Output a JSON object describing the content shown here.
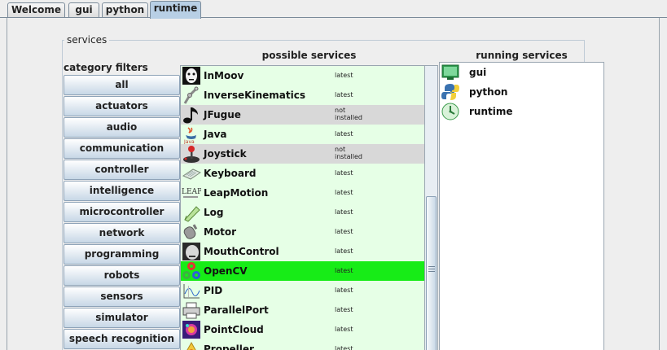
{
  "tabs": [
    "Welcome",
    "gui",
    "python",
    "runtime"
  ],
  "services_title": "services",
  "category_filters": {
    "title": "category filters",
    "items": [
      "all",
      "actuators",
      "audio",
      "communication",
      "controller",
      "intelligence",
      "microcontroller",
      "network",
      "programming",
      "robots",
      "sensors",
      "simulator",
      "speech recognition"
    ]
  },
  "possible_services": {
    "title": "possible services",
    "rows": [
      {
        "name": "InMoov",
        "status": "latest",
        "icon": "inmoov-face-icon"
      },
      {
        "name": "InverseKinematics",
        "status": "latest",
        "icon": "robot-arm-icon"
      },
      {
        "name": "JFugue",
        "status": "not installed",
        "status_line1": "not",
        "status_line2": "installed",
        "icon": "music-note-icon"
      },
      {
        "name": "Java",
        "status": "latest",
        "icon": "java-icon"
      },
      {
        "name": "Joystick",
        "status": "not installed",
        "status_line1": "not",
        "status_line2": "installed",
        "icon": "joystick-icon"
      },
      {
        "name": "Keyboard",
        "status": "latest",
        "icon": "keyboard-icon"
      },
      {
        "name": "LeapMotion",
        "status": "latest",
        "icon": "leap-icon"
      },
      {
        "name": "Log",
        "status": "latest",
        "icon": "log-icon"
      },
      {
        "name": "Motor",
        "status": "latest",
        "icon": "motor-icon"
      },
      {
        "name": "MouthControl",
        "status": "latest",
        "icon": "mouth-icon"
      },
      {
        "name": "OpenCV",
        "status": "latest",
        "icon": "opencv-icon"
      },
      {
        "name": "PID",
        "status": "latest",
        "icon": "pid-icon"
      },
      {
        "name": "ParallelPort",
        "status": "latest",
        "icon": "printer-icon"
      },
      {
        "name": "PointCloud",
        "status": "latest",
        "icon": "pointcloud-icon"
      },
      {
        "name": "Propeller",
        "status": "latest",
        "icon": "propeller-icon"
      }
    ]
  },
  "running_services": {
    "title": "running services",
    "rows": [
      {
        "name": "gui",
        "icon": "gui-icon"
      },
      {
        "name": "python",
        "icon": "python-icon"
      },
      {
        "name": "runtime",
        "icon": "runtime-icon"
      }
    ]
  },
  "colors": {
    "latest_bg": "#e6ffe6",
    "not_installed_bg": "#d8d8d8",
    "selected_bg": "#17ec17",
    "active_tab": "#b8cfe5"
  }
}
